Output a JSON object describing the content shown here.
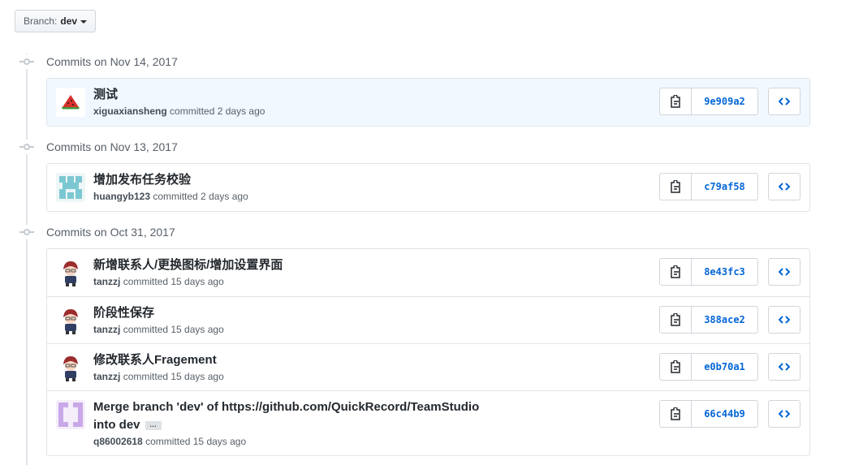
{
  "branch": {
    "label": "Branch:",
    "value": "dev"
  },
  "groups": [
    {
      "title": "Commits on Nov 14, 2017",
      "commits": [
        {
          "message": "测试",
          "author": "xiguaxiansheng",
          "action": "committed 2 days ago",
          "sha": "9e909a2",
          "avatar": "watermelon-avatar"
        }
      ]
    },
    {
      "title": "Commits on Nov 13, 2017",
      "commits": [
        {
          "message": "增加发布任务校验",
          "author": "huangyb123",
          "action": "committed 2 days ago",
          "sha": "c79af58",
          "avatar": "identicon-teal"
        }
      ]
    },
    {
      "title": "Commits on Oct 31, 2017",
      "commits": [
        {
          "message": "新增联系人/更换图标/增加设置界面",
          "author": "tanzzj",
          "action": "committed 15 days ago",
          "sha": "8e43fc3",
          "avatar": "anime-avatar"
        },
        {
          "message": "阶段性保存",
          "author": "tanzzj",
          "action": "committed 15 days ago",
          "sha": "388ace2",
          "avatar": "anime-avatar"
        },
        {
          "message": "修改联系人Fragement",
          "author": "tanzzj",
          "action": "committed 15 days ago",
          "sha": "e0b70a1",
          "avatar": "anime-avatar"
        },
        {
          "message": "Merge branch 'dev' of https://github.com/QuickRecord/TeamStudio",
          "message_cont": "into dev",
          "ellipsis": "…",
          "author": "q86002618",
          "action": "committed 15 days ago",
          "sha": "66c44b9",
          "avatar": "identicon-purple"
        }
      ]
    }
  ],
  "colors": {
    "link": "#0366d6",
    "highlight": "#f1f8ff",
    "border": "#e1e4e8"
  }
}
